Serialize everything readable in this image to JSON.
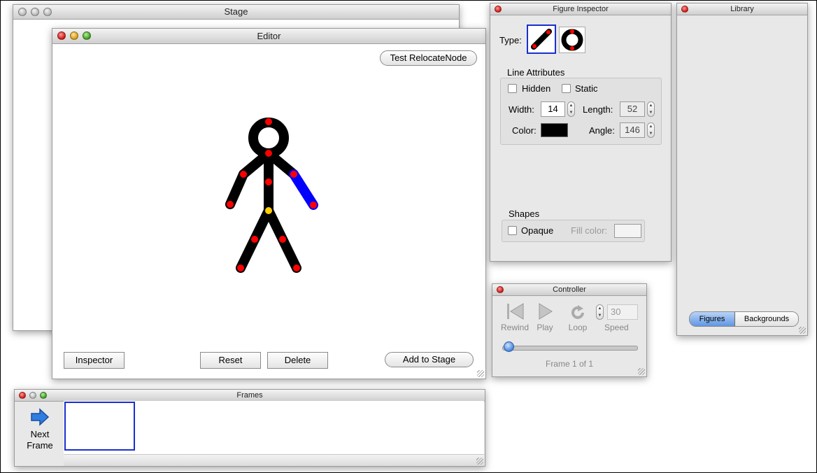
{
  "stage": {
    "title": "Stage"
  },
  "editor": {
    "title": "Editor",
    "test_button": "Test RelocateNode",
    "inspector_button": "Inspector",
    "reset_button": "Reset",
    "delete_button": "Delete",
    "add_button": "Add to Stage"
  },
  "frames": {
    "title": "Frames",
    "next_label": "Next Frame"
  },
  "inspector": {
    "title": "Figure Inspector",
    "type_label": "Type:",
    "line_attributes_label": "Line Attributes",
    "hidden_label": "Hidden",
    "static_label": "Static",
    "width_label": "Width:",
    "width_value": "14",
    "length_label": "Length:",
    "length_value": "52",
    "color_label": "Color:",
    "color_value": "#000000",
    "angle_label": "Angle:",
    "angle_value": "146",
    "shapes_label": "Shapes",
    "opaque_label": "Opaque",
    "fill_color_label": "Fill color:"
  },
  "controller": {
    "title": "Controller",
    "rewind_label": "Rewind",
    "play_label": "Play",
    "loop_label": "Loop",
    "speed_label": "Speed",
    "speed_value": "30",
    "frame_status": "Frame 1 of 1",
    "slider_position": 0
  },
  "library": {
    "title": "Library",
    "tab_figures": "Figures",
    "tab_backgrounds": "Backgrounds"
  },
  "colors": {
    "joint": "#ff0000",
    "root_joint": "#ffcc00",
    "selected_limb": "#0000ff",
    "selection_border": "#1a2fd0"
  }
}
